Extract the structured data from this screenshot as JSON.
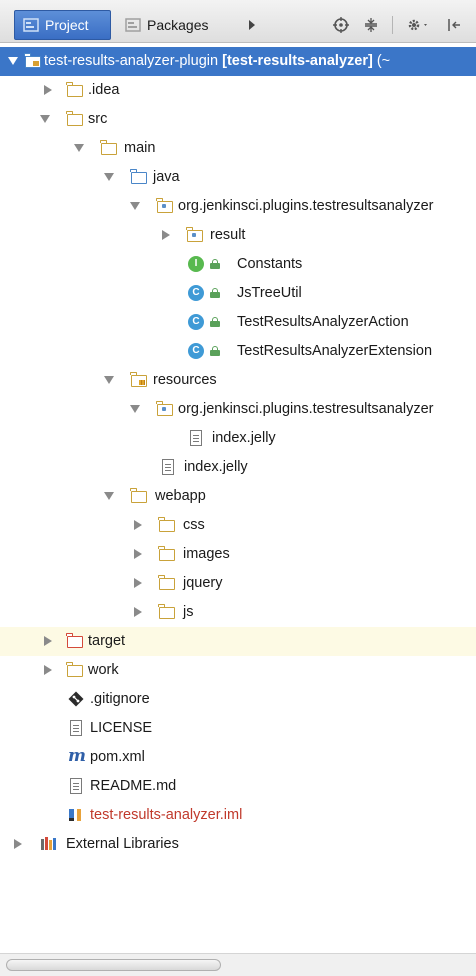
{
  "toolbar": {
    "tabs": [
      {
        "label": "Project",
        "active": true
      },
      {
        "label": "Packages",
        "active": false
      }
    ],
    "buttons": [
      "more-tabs",
      "crosshair",
      "collapse",
      "settings",
      "hide"
    ]
  },
  "tree": {
    "root": {
      "name": "test-results-analyzer-plugin",
      "module": "[test-results-analyzer]",
      "suffix": "(~"
    },
    "idea": ".idea",
    "src": "src",
    "main": "main",
    "java": "java",
    "pkg1": "org.jenkinsci.plugins.testresultsanalyzer",
    "result": "result",
    "constants": "Constants",
    "jstreeutil": "JsTreeUtil",
    "action": "TestResultsAnalyzerAction",
    "extension": "TestResultsAnalyzerExtension",
    "resources": "resources",
    "pkg2": "org.jenkinsci.plugins.testresultsanalyzer",
    "index1": "index.jelly",
    "index2": "index.jelly",
    "webapp": "webapp",
    "css": "css",
    "images": "images",
    "jquery": "jquery",
    "js": "js",
    "target": "target",
    "work": "work",
    "gitignore": ".gitignore",
    "license": "LICENSE",
    "pom": "pom.xml",
    "readme": "README.md",
    "iml": "test-results-analyzer.iml",
    "ext_libs": "External Libraries"
  },
  "colors": {
    "selection": "#3b76c8",
    "highlight_row": "#fdfae4",
    "excluded_text": "#c0392b"
  }
}
